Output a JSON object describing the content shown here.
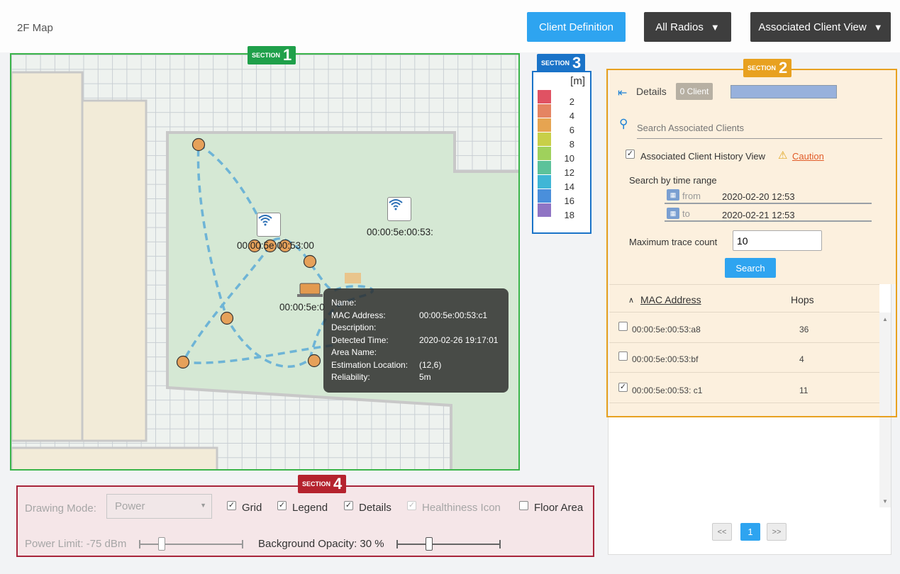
{
  "header": {
    "map_title": "2F Map",
    "client_definition": "Client Definition",
    "all_radios": "All Radios",
    "assoc_view": "Associated Client View",
    "caret": "▼"
  },
  "sections": {
    "s1": {
      "label": "SECTION",
      "num": "1",
      "color": "#1fa04a"
    },
    "s2": {
      "label": "SECTION",
      "num": "2",
      "color": "#e8a120"
    },
    "s3": {
      "label": "SECTION",
      "num": "3",
      "color": "#1a73c8"
    },
    "s4": {
      "label": "SECTION",
      "num": "4",
      "color": "#b5232e"
    }
  },
  "map": {
    "ap1_label": "00:00:5e:00:53:00",
    "ap2_label": "00:00:5e:00:53:",
    "client_label": "00:00:5e:0",
    "tooltip": {
      "name_k": "Name:",
      "name_v": "",
      "mac_k": "MAC Address:",
      "mac_v": "00:00:5e:00:53:c1",
      "desc_k": "Description:",
      "desc_v": "",
      "time_k": "Detected Time:",
      "time_v": "2020-02-26 19:17:01",
      "area_k": "Area Name:",
      "area_v": "",
      "loc_k": "Estimation Location:",
      "loc_v": "(12,6)",
      "rel_k": "Reliability:",
      "rel_v": "5m"
    }
  },
  "legend": {
    "unit": "[m]",
    "items": [
      {
        "value": "2",
        "color": "#e05263"
      },
      {
        "value": "4",
        "color": "#e58462"
      },
      {
        "value": "6",
        "color": "#e6a451"
      },
      {
        "value": "8",
        "color": "#c8cf48"
      },
      {
        "value": "10",
        "color": "#9fd15c"
      },
      {
        "value": "12",
        "color": "#5cc29a"
      },
      {
        "value": "14",
        "color": "#3fb6d6"
      },
      {
        "value": "16",
        "color": "#4a8fdb"
      },
      {
        "value": "18",
        "color": "#8f74c4"
      }
    ]
  },
  "panel": {
    "details": "Details",
    "client_badge": "0 Client",
    "search_placeholder": "Search Associated Clients",
    "history_label": "Associated Client History View",
    "caution": "Caution",
    "time_range": "Search by time range",
    "from_label": "from",
    "from_value": "2020-02-20 12:53",
    "to_label": "to",
    "to_value": "2020-02-21 12:53",
    "max_trace_label": "Maximum trace count",
    "max_trace_value": "10",
    "search_button": "Search",
    "col_mac": "MAC Address",
    "col_hops": "Hops",
    "rows": [
      {
        "mac": "00:00:5e:00:53:a8",
        "hops": "36",
        "checked": false
      },
      {
        "mac": "00:00:5e:00:53:bf",
        "hops": "4",
        "checked": false
      },
      {
        "mac": "00:00:5e:00:53: c1",
        "hops": "11",
        "checked": true
      }
    ],
    "pager": {
      "prev": "<<",
      "current": "1",
      "next": ">>"
    }
  },
  "controls": {
    "drawing_mode_label": "Drawing Mode:",
    "drawing_mode_value": "Power",
    "grid": "Grid",
    "legend": "Legend",
    "details": "Details",
    "healthiness": "Healthiness Icon",
    "floor_area": "Floor Area",
    "power_limit": "Power Limit: -75 dBm",
    "bg_opacity": "Background Opacity: 30 %"
  }
}
